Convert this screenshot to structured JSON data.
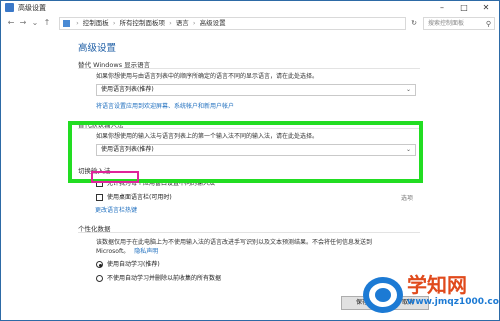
{
  "window": {
    "title": "高级设置"
  },
  "address": {
    "breadcrumb": [
      "控制面板",
      "所有控制面板项",
      "语言",
      "高级设置"
    ],
    "search_placeholder": "搜索控制面板"
  },
  "page": {
    "heading": "高级设置",
    "display_lang": {
      "title": "替代 Windows 显示语言",
      "desc": "如果你想使用与由语言列表中的顺序所确定的语言不同的显示语言，请在此处选择。",
      "select_value": "使用语言列表(推荐)",
      "link_text": "将语言设置应用到欢迎屏幕、系统帐户和新用户帐户"
    },
    "default_input": {
      "title": "替代默认输入法",
      "desc": "如果你想使用的输入法与语言列表上的第一个输入法不同的输入法，请在此处选择。",
      "select_value": "使用语言列表(推荐)"
    },
    "switch_input": {
      "title": "切换输入法",
      "check1": "允许我为每个应用窗口设置不同的输入法",
      "check2": "使用桌面语言栏(可用时)",
      "options_link": "选项",
      "hotkey_link": "更改语言栏热键"
    },
    "personalization": {
      "title": "个性化数据",
      "desc_line1": "该数据仅用于在此电脑上为不使用输入法的语言改进手写识别以及文本预测结果。不会将任何信息发送到",
      "desc_line2": "Microsoft。",
      "privacy_link": "隐私声明",
      "radio1": "使用自动学习(推荐)",
      "radio2": "不使用自动学习并删除以前收集的所有数据"
    },
    "buttons": {
      "save": "保存",
      "cancel": "取消"
    }
  },
  "watermark": {
    "text": "学知网",
    "url": "www.jmqz1000.com"
  }
}
